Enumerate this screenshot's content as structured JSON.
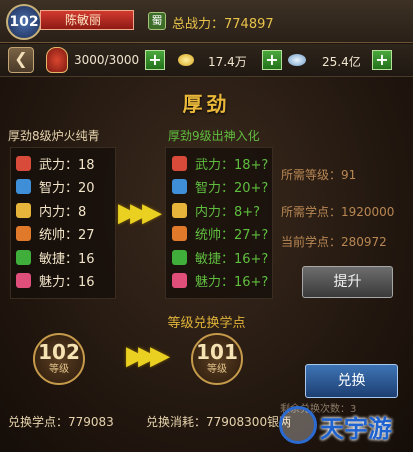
{
  "header": {
    "level": "102",
    "name": "陈敏丽",
    "faction": "蜀",
    "power_text": "总战力：774897"
  },
  "resources": {
    "back_symbol": "❮",
    "stamina": "3000/3000",
    "gold": "17.4万",
    "silver": "25.4亿",
    "plus_symbol": "+"
  },
  "title": "厚劲",
  "current": {
    "heading": "厚劲8级炉火纯青",
    "stats": [
      {
        "label": "武力：18",
        "icon": "sword-icon",
        "color": "#d84a3a"
      },
      {
        "label": "智力：20",
        "icon": "feather-icon",
        "color": "#3f8fd8"
      },
      {
        "label": "内力：8",
        "icon": "yin-yang-icon",
        "color": "#e6b43a"
      },
      {
        "label": "统帅：27",
        "icon": "flag-icon",
        "color": "#e07a2a"
      },
      {
        "label": "敏捷：16",
        "icon": "boot-icon",
        "color": "#3fae3a"
      },
      {
        "label": "魅力：16",
        "icon": "flower-icon",
        "color": "#e04f7a"
      }
    ]
  },
  "next": {
    "heading": "厚劲9级出神入化",
    "stats": [
      {
        "label": "武力：18+?",
        "icon": "sword-icon",
        "color": "#d84a3a"
      },
      {
        "label": "智力：20+?",
        "icon": "feather-icon",
        "color": "#3f8fd8"
      },
      {
        "label": "内力：8+?",
        "icon": "yin-yang-icon",
        "color": "#e6b43a"
      },
      {
        "label": "统帅：27+?",
        "icon": "flag-icon",
        "color": "#e07a2a"
      },
      {
        "label": "敏捷：16+?",
        "icon": "boot-icon",
        "color": "#3fae3a"
      },
      {
        "label": "魅力：16+?",
        "icon": "flower-icon",
        "color": "#e04f7a"
      }
    ]
  },
  "requirements": {
    "level": "所需等级：91",
    "points": "所需学点：1920000",
    "current_points": "当前学点：280972"
  },
  "upgrade_button": "提升",
  "exchange": {
    "title": "等级兑换学点",
    "from_level": "102",
    "to_level": "101",
    "level_label": "等级",
    "button": "兑换",
    "remaining": "剩余兑换次数：3",
    "points_label": "兑换学点：779083",
    "cost_label": "兑换消耗：77908300银两"
  },
  "watermark": "天宇游",
  "arrow_glyph": "▶▶▶"
}
